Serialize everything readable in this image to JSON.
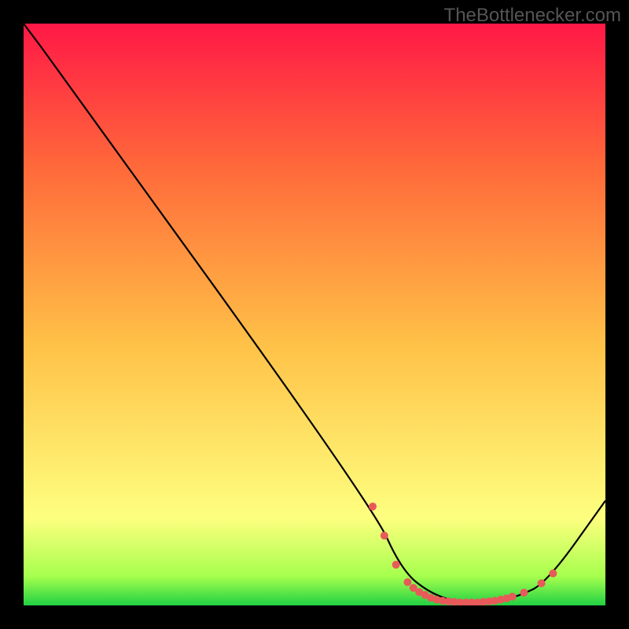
{
  "attribution": "TheBottlenecker.com",
  "chart_data": {
    "type": "line",
    "title": "",
    "xlabel": "",
    "ylabel": "",
    "xlim": [
      0,
      100
    ],
    "ylim": [
      0,
      100
    ],
    "background_gradient": [
      "#21d143",
      "#feff7f",
      "#ffd247",
      "#ff6a3a",
      "#ff1846"
    ],
    "series": [
      {
        "name": "curve",
        "color": "#000000",
        "x": [
          0,
          6,
          60,
          65,
          70,
          75,
          80,
          85,
          90,
          100
        ],
        "y": [
          100,
          92,
          17,
          6,
          2,
          0.5,
          0.5,
          1.5,
          4,
          18
        ]
      }
    ],
    "markers": {
      "color": "#e85a5a",
      "size": 5,
      "points": [
        {
          "x": 60,
          "y": 17
        },
        {
          "x": 62,
          "y": 12
        },
        {
          "x": 64,
          "y": 7
        },
        {
          "x": 66,
          "y": 4
        },
        {
          "x": 67,
          "y": 3
        },
        {
          "x": 68,
          "y": 2.3
        },
        {
          "x": 69,
          "y": 1.8
        },
        {
          "x": 70,
          "y": 1.3
        },
        {
          "x": 71,
          "y": 1.0
        },
        {
          "x": 72,
          "y": 0.8
        },
        {
          "x": 73,
          "y": 0.7
        },
        {
          "x": 74,
          "y": 0.6
        },
        {
          "x": 75,
          "y": 0.5
        },
        {
          "x": 76,
          "y": 0.5
        },
        {
          "x": 77,
          "y": 0.5
        },
        {
          "x": 78,
          "y": 0.5
        },
        {
          "x": 79,
          "y": 0.6
        },
        {
          "x": 80,
          "y": 0.7
        },
        {
          "x": 81,
          "y": 0.8
        },
        {
          "x": 82,
          "y": 1.0
        },
        {
          "x": 83,
          "y": 1.2
        },
        {
          "x": 84,
          "y": 1.5
        },
        {
          "x": 86,
          "y": 2.2
        },
        {
          "x": 89,
          "y": 3.8
        },
        {
          "x": 91,
          "y": 5.5
        }
      ]
    }
  }
}
